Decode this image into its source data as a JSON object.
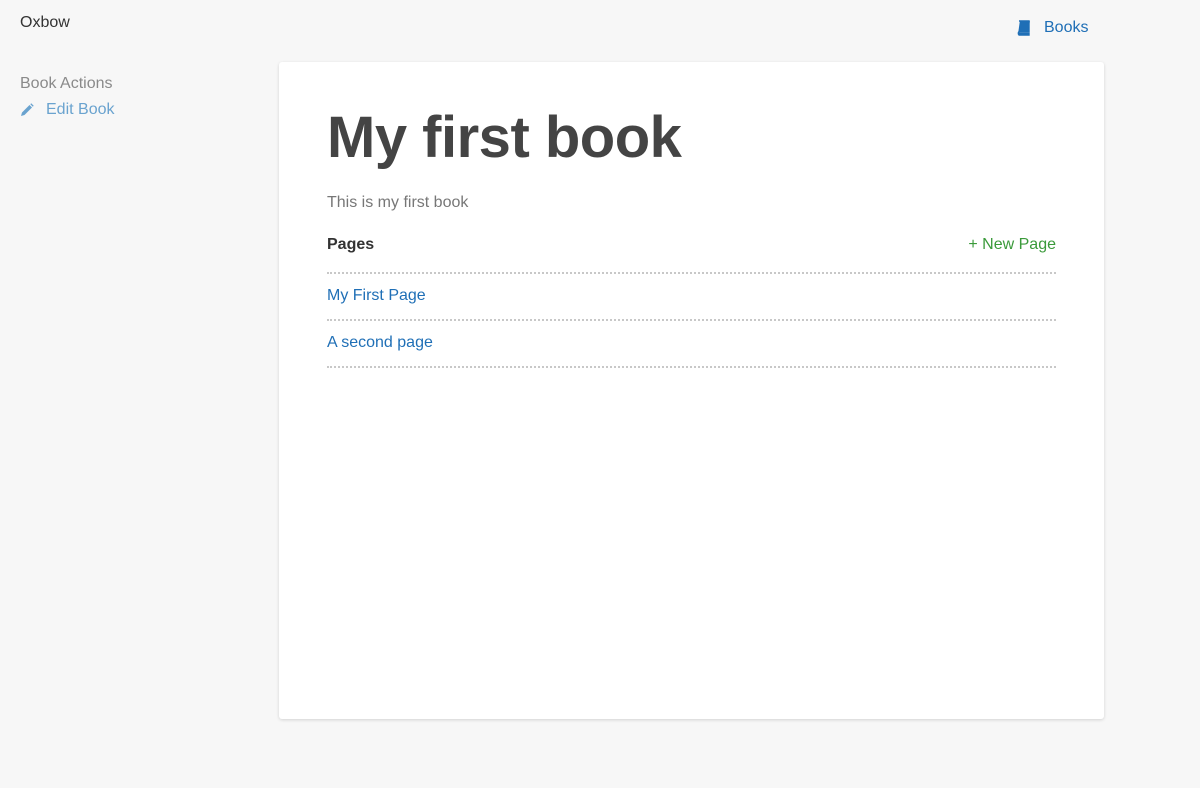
{
  "header": {
    "brand": "Oxbow",
    "nav_books_label": "Books",
    "nav_books_icon": "book-icon"
  },
  "sidebar": {
    "heading": "Book Actions",
    "items": [
      {
        "label": "Edit Book",
        "icon": "pencil-icon"
      }
    ]
  },
  "main": {
    "title": "My first book",
    "description": "This is my first book",
    "pages_label": "Pages",
    "new_page_label": "+ New Page",
    "pages": [
      {
        "title": "My First Page"
      },
      {
        "title": "A second page"
      }
    ]
  },
  "colors": {
    "link": "#1f6fb6",
    "sidebar_link": "#6aa3cf",
    "new_page": "#3a9a3a",
    "background": "#f7f7f7"
  }
}
